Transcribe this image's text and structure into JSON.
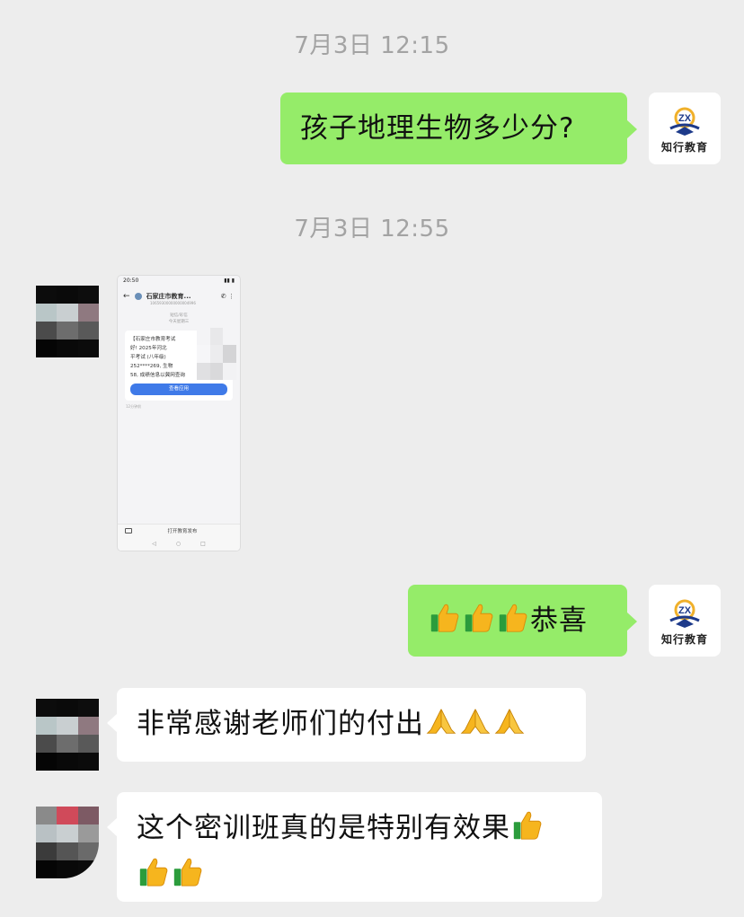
{
  "timestamps": [
    "7月3日 12:15",
    "7月3日 12:55"
  ],
  "brand": {
    "name": "知行教育",
    "logo_letters": "ZX"
  },
  "messages": {
    "m1": {
      "sender": "me",
      "text": "孩子地理生物多少分?"
    },
    "m3": {
      "sender": "me",
      "emoji": [
        "thumbs-up",
        "thumbs-up",
        "thumbs-up"
      ],
      "text": "恭喜"
    },
    "m4": {
      "sender": "other",
      "text": "非常感谢老师们的付出",
      "emoji": [
        "pray",
        "pray",
        "pray"
      ]
    },
    "m5": {
      "sender": "other",
      "text": "这个密训班真的是特别有效果",
      "emoji": [
        "thumbs-up",
        "thumbs-up",
        "thumbs-up"
      ]
    }
  },
  "screenshot": {
    "status_time": "20:50",
    "title": "石家庄市教育...",
    "subtitle": "10659300000000004996",
    "meta_line1": "短信/彩信",
    "meta_line2": "今天星期三",
    "sms_lines": [
      "【石家庄市教育考试",
      "好! 2025年河北",
      "平考试 (八年级)",
      "252****269, 生物",
      "58, 成绩信息以冀网查询"
    ],
    "button": "查看应用",
    "sms_time": "12分钟前",
    "bottom_action": "打开教育发布"
  },
  "colors": {
    "chat_bg": "#ededed",
    "my_bubble": "#95ec69",
    "their_bubble": "#ffffff",
    "timestamp": "#a3a3a3",
    "sms_button": "#3f7ae8"
  }
}
